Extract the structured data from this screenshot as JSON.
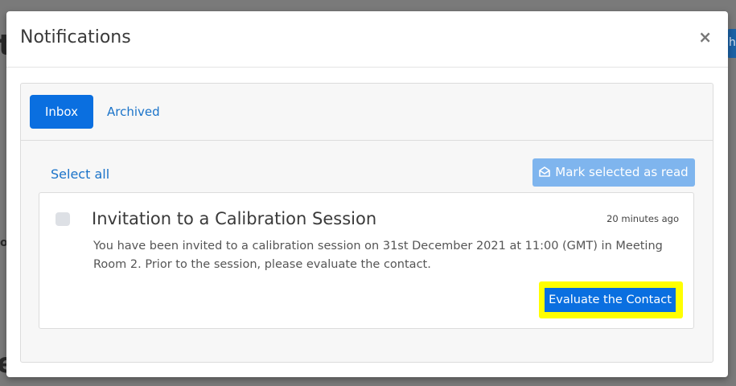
{
  "background": {
    "glyph_top": "t",
    "glyph_mid": "o",
    "glyph_bottom": "e",
    "button_fragment": "h"
  },
  "modal": {
    "title": "Notifications",
    "close_label": "×"
  },
  "tabs": [
    {
      "label": "Inbox",
      "active": true
    },
    {
      "label": "Archived",
      "active": false
    }
  ],
  "toolbar": {
    "select_all_label": "Select all",
    "mark_read_label": "Mark selected as read",
    "mark_read_icon": "envelope-open-icon"
  },
  "notifications": [
    {
      "title": "Invitation to a Calibration Session",
      "time": "20 minutes ago",
      "body": "You have been invited to a calibration session on 31st December 2021 at 11:00 (GMT) in Meeting Room 2. Prior to the session, please evaluate the contact.",
      "action_label": "Evaluate the Contact",
      "checked": false
    }
  ],
  "colors": {
    "primary": "#0a6fe0",
    "link": "#1a73c9",
    "disabled_button": "#7fb5ee",
    "highlight": "#ffff00",
    "overlay": "#7a7a7a"
  }
}
